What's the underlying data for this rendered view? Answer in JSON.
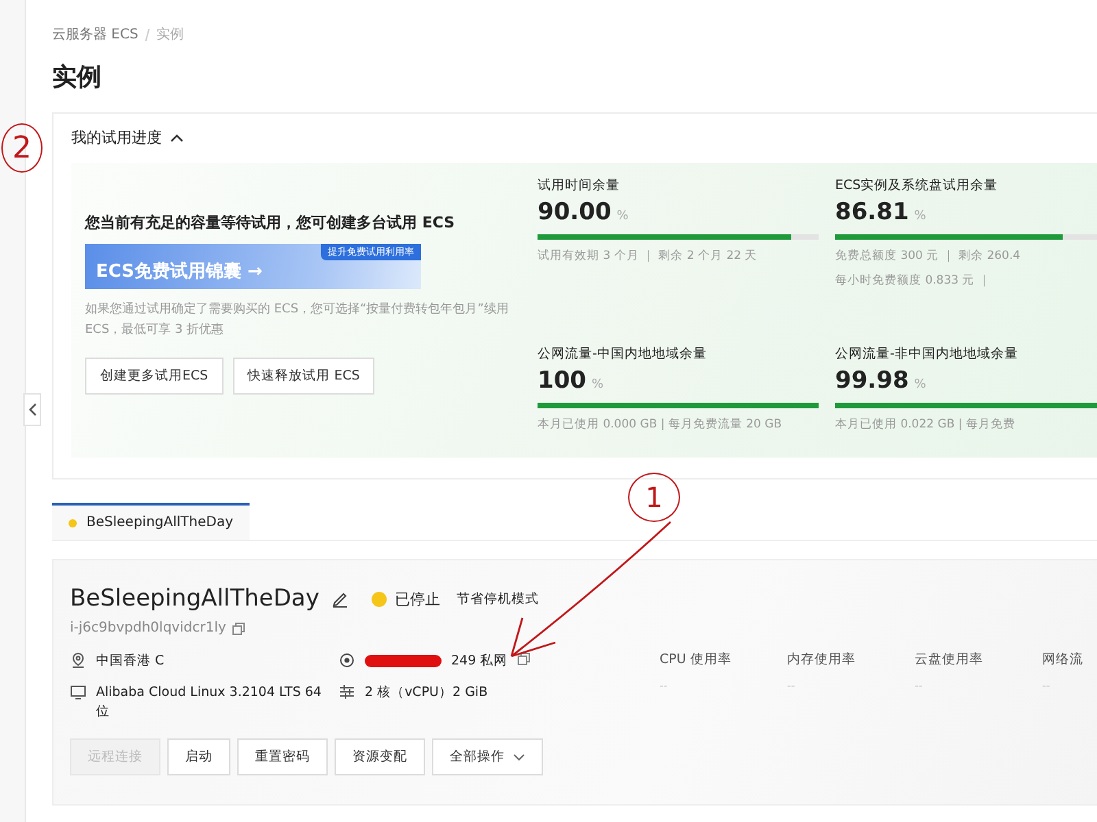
{
  "breadcrumb": [
    "云服务器 ECS",
    "实例"
  ],
  "title": "实例",
  "trial": {
    "heading": "我的试用进度",
    "expanded": true,
    "promo_title": "您当前有充足的容量等待试用，您可创建多台试用 ECS",
    "banner": {
      "text": "ECS免费试用锦囊 →",
      "badge": "提升免费试用利用率"
    },
    "description": "如果您通过试用确定了需要购买的 ECS，您可选择“按量付费转包年包月”续用 ECS，最低可享 3 折优惠",
    "buttons": [
      "创建更多试用ECS",
      "快速释放试用 ECS"
    ],
    "metrics": [
      {
        "label": "试用时间余量",
        "value": "90.00",
        "unit": "%",
        "level": 0.9,
        "notes": [
          "试用有效期 3 个月 ｜ 剩余 2 个月 22 天"
        ]
      },
      {
        "label": "ECS实例及系统盘试用余量",
        "value": "86.81",
        "unit": "%",
        "level": 0.8681,
        "notes": [
          "免费总额度 300 元 ｜ 剩余 260.4",
          "每小时免费额度 0.833 元 ｜"
        ]
      },
      {
        "label": "公网流量-中国内地地域余量",
        "value": "100",
        "unit": "%",
        "level": 1,
        "notes": [
          "本月已使用 0.000 GB | 每月免费流量 20 GB"
        ]
      },
      {
        "label": "公网流量-非中国内地地域余量",
        "value": "99.98",
        "unit": "%",
        "level": 0.9998,
        "notes": [
          "本月已使用 0.022 GB | 每月免费"
        ]
      }
    ]
  },
  "tabs": [
    {
      "label": "BeSleepingAllTheDay",
      "selected": true,
      "color": "#f5c518"
    }
  ],
  "instance": {
    "name": "BeSleepingAllTheDay",
    "status": "已停止",
    "color": "#f5c518",
    "mode": "节省停机模式",
    "id": "i-j6c9bvpdh0lqvidcr1ly",
    "region": "中国香港 C",
    "ip": "249 私网",
    "ip_redacted": true,
    "os": "Alibaba Cloud Linux 3.2104 LTS 64 位",
    "spec": "2 核（vCPU）2 GiB",
    "actions": [
      {
        "label": "远程连接",
        "disabled": true,
        "kind": "button"
      },
      {
        "label": "启动",
        "disabled": false,
        "kind": "button"
      },
      {
        "label": "重置密码",
        "disabled": false,
        "kind": "button"
      },
      {
        "label": "资源变配",
        "disabled": false,
        "kind": "button"
      },
      {
        "label": "全部操作",
        "disabled": false,
        "kind": "dropdown"
      }
    ],
    "usage": [
      {
        "label": "CPU 使用率",
        "value": "--"
      },
      {
        "label": "内存使用率",
        "value": "--"
      },
      {
        "label": "云盘使用率",
        "value": "--"
      },
      {
        "label": "网络流",
        "value": "--"
      }
    ]
  },
  "annotations": [
    {
      "kind": "circle",
      "text": "2"
    },
    {
      "kind": "circle",
      "text": "1"
    },
    {
      "kind": "arrow"
    }
  ]
}
